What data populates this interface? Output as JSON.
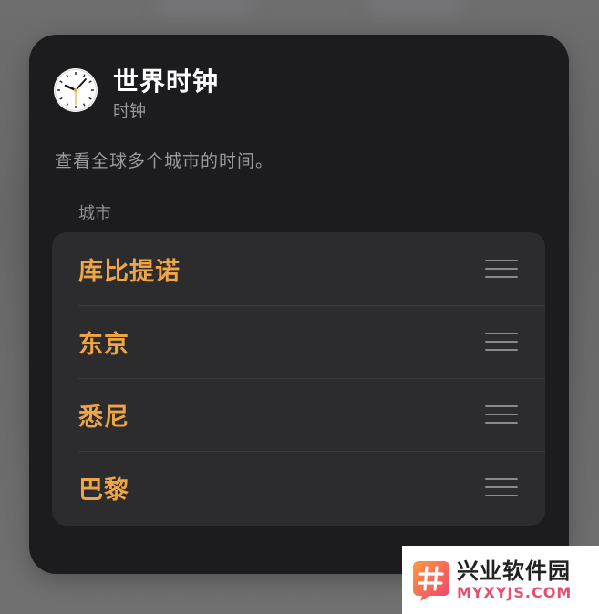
{
  "widget": {
    "app_name": "世界时钟",
    "app_subtitle": "时钟",
    "description": "查看全球多个城市的时间。",
    "icon": "analog-clock-icon"
  },
  "cities_section": {
    "header": "城市",
    "drag_icon": "reorder-handle-icon",
    "items": [
      {
        "name": "库比提诺"
      },
      {
        "name": "东京"
      },
      {
        "name": "悉尼"
      },
      {
        "name": "巴黎"
      }
    ]
  },
  "colors": {
    "card_background": "#1c1c1e",
    "list_background": "#2c2c2e",
    "accent": "#f0a544",
    "secondary_text": "#9a9aa0"
  },
  "watermark": {
    "name": "兴业软件园",
    "domain": "MYXYJS.COM"
  }
}
